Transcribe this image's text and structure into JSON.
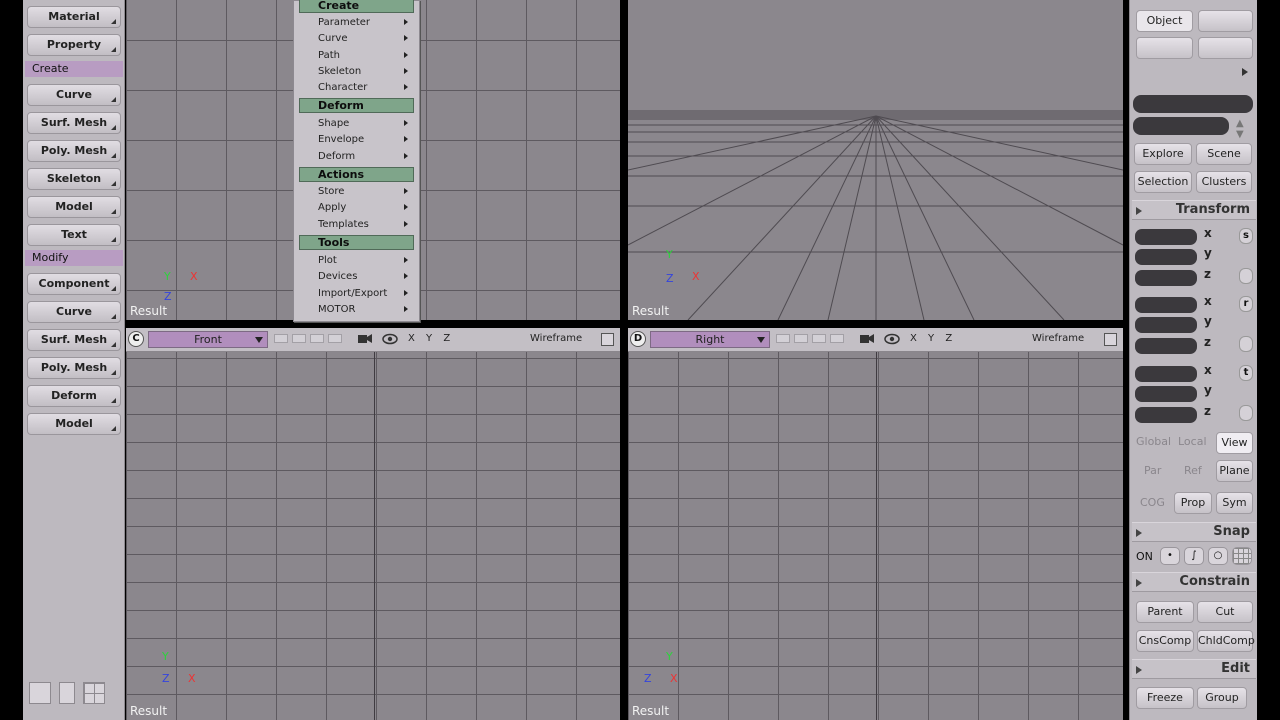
{
  "left_toolbar": {
    "top_items": [
      "Material",
      "Property"
    ],
    "create_header": "Create",
    "create_items": [
      "Curve",
      "Surf. Mesh",
      "Poly. Mesh",
      "Skeleton",
      "Model",
      "Text"
    ],
    "modify_header": "Modify",
    "modify_items": [
      "Component",
      "Curve",
      "Surf. Mesh",
      "Poly. Mesh",
      "Deform",
      "Model"
    ]
  },
  "menu": {
    "create_header": "Create",
    "create_items": [
      "Parameter",
      "Curve",
      "Path",
      "Skeleton",
      "Character"
    ],
    "deform_header": "Deform",
    "deform_items": [
      "Shape",
      "Envelope",
      "Deform"
    ],
    "actions_header": "Actions",
    "actions_items": [
      "Store",
      "Apply",
      "Templates"
    ],
    "tools_header": "Tools",
    "tools_items": [
      "Plot",
      "Devices",
      "Import/Export",
      "MOTOR"
    ]
  },
  "viewports": {
    "top_left": {
      "result": "Result",
      "axes": {
        "y": "Y",
        "x": "X",
        "z": "Z"
      }
    },
    "top_right": {
      "result": "Result",
      "axes": {
        "y": "Y",
        "x": "X",
        "z": "Z"
      }
    },
    "bottom_left": {
      "camera_letter": "C",
      "name": "Front",
      "xyz": "X Y Z",
      "mode": "Wireframe",
      "result": "Result",
      "axes": {
        "y": "Y",
        "x": "X",
        "z": "Z"
      }
    },
    "bottom_right": {
      "camera_letter": "D",
      "name": "Right",
      "xyz": "X Y Z",
      "mode": "Wireframe",
      "result": "Result",
      "axes": {
        "y": "Y",
        "x": "X",
        "z": "Z"
      }
    }
  },
  "right_panel": {
    "object_label": "Object",
    "explore": "Explore",
    "scene": "Scene",
    "selection": "Selection",
    "clusters": "Clusters",
    "transform_title": "Transform",
    "axis_x": "x",
    "axis_y": "y",
    "axis_z": "z",
    "scale_btn": "s",
    "rotate_btn": "r",
    "translate_btn": "t",
    "global": "Global",
    "local": "Local",
    "view": "View",
    "par": "Par",
    "ref": "Ref",
    "plane": "Plane",
    "cog": "COG",
    "prop": "Prop",
    "sym": "Sym",
    "snap_title": "Snap",
    "snap_on": "ON",
    "constrain_title": "Constrain",
    "parent": "Parent",
    "cut": "Cut",
    "cnscomp": "CnsComp",
    "chldcomp": "ChldComp",
    "edit_title": "Edit",
    "freeze": "Freeze",
    "group": "Group"
  },
  "colors": {
    "viewport_bg": "#8b878d",
    "menu_header": "#7fa58a",
    "left_header": "#b89cc2",
    "panel_bg": "#bdb9bf"
  }
}
